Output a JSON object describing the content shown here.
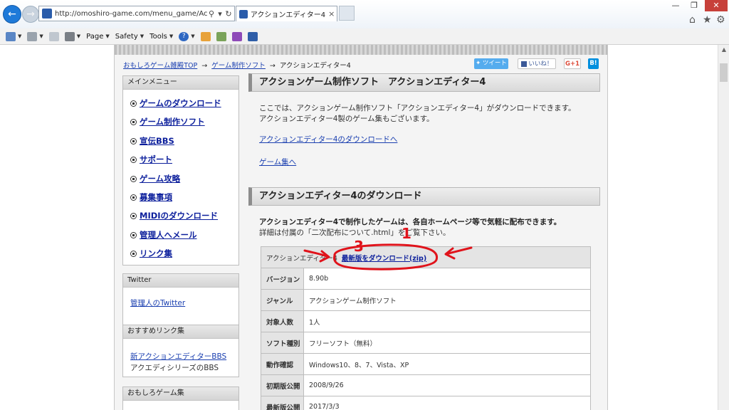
{
  "browser": {
    "url": "http://omoshiro-game.com/menu_game/ActionEdito",
    "tab_title": "アクションエディター4",
    "tab_suffix": "|...",
    "tab_close": "×",
    "window_controls": {
      "minimize": "—",
      "restore": "❐",
      "close": "✕"
    },
    "right_icons": {
      "home": "⌂",
      "favorites": "★",
      "settings": "⚙"
    }
  },
  "command_bar": {
    "page_label": "Page",
    "safety_label": "Safety",
    "tools_label": "Tools",
    "help_icon": "?"
  },
  "breadcrumb": {
    "home": "おもしろゲーム雑殿TOP",
    "section": "ゲーム制作ソフト",
    "current": "アクションエディター4",
    "separator": "→"
  },
  "social": {
    "tweet": "ツイート",
    "like": "いいね！",
    "gplus": "G+1",
    "hatena": "B!"
  },
  "sidebar": {
    "main_menu_title": "メインメニュー",
    "items": [
      {
        "label": "ゲームのダウンロード"
      },
      {
        "label": "ゲーム制作ソフト"
      },
      {
        "label": "宣伝BBS"
      },
      {
        "label": "サポート"
      },
      {
        "label": "ゲーム攻略"
      },
      {
        "label": "募集事項"
      },
      {
        "label": "MIDIのダウンロード"
      },
      {
        "label": "管理人へメール"
      },
      {
        "label": "リンク集"
      }
    ],
    "twitter_title": "Twitter",
    "twitter_link": "管理人のTwitter",
    "links_title": "おすすめリンク集",
    "bbs_link": "新アクションエディターBBS",
    "bbs_text": "アクエディシリーズのBBS",
    "games_title": "おもしろゲーム集"
  },
  "main": {
    "heading1": "アクションゲーム制作ソフト　アクションエディター4",
    "intro_line1": "ここでは、アクションゲーム制作ソフト「アクションエディター4」がダウンロードできます。",
    "intro_line2": "アクションエディター4製のゲーム集もございます。",
    "download_link": "アクションエディター4のダウンロードへ",
    "games_link": "ゲーム集へ",
    "heading2": "アクションエディター4のダウンロード",
    "bold_line": "アクションエディター4で制作したゲームは、各自ホームページ等で気軽に配布できます。",
    "detail_line": "詳細は付属の「二次配布について.html」をご覧下さい。",
    "table": {
      "first_label": "アクションエディター4",
      "download_latest": "最新版をダウンロード(zip)",
      "rows": [
        {
          "key": "バージョン",
          "value": "8.90b"
        },
        {
          "key": "ジャンル",
          "value": "アクションゲーム制作ソフト"
        },
        {
          "key": "対象人数",
          "value": "1人"
        },
        {
          "key": "ソフト種別",
          "value": "フリーソフト（無料）"
        },
        {
          "key": "動作確認",
          "value": "Windows10、8、7、Vista、XP"
        },
        {
          "key": "初期版公開",
          "value": "2008/9/26"
        },
        {
          "key": "最新版公開",
          "value": "2017/3/3"
        }
      ]
    }
  },
  "annotations": {
    "color": "#e0131b",
    "marks": [
      "3",
      "1"
    ]
  },
  "colors": {
    "link": "#1a3fb0",
    "menu_link": "#0c1f9c",
    "tweet": "#55acee",
    "hatena": "#008fde",
    "ie_blue": "#1e7ad9"
  }
}
